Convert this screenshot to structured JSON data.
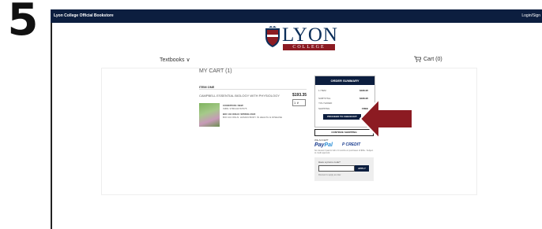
{
  "step_number": "5",
  "topbar": {
    "store_name": "Lyon College Official Bookstore",
    "login": "Login/Sign"
  },
  "logo": {
    "name": "LYON",
    "sub": "COLLEGE"
  },
  "nav": {
    "textbooks": "Textbooks ∨",
    "cart": "Cart (0)"
  },
  "cart": {
    "heading": "MY CART (1)",
    "section": "ITEM ONE",
    "item": {
      "title": "CAMPBELL ESSENTIAL BIOLOGY WITH PHYSIOLOGY",
      "price": "$193.35",
      "qty": "1 ∨",
      "condition": "CONDITION: NEW",
      "isbn": "ISBN: 9780134767575",
      "course1": "BIO 104 ONLN: SPRING 2022",
      "course2": "BIO 104 ONLN: HUMAN BODY IN HEALTH & DISEASE"
    }
  },
  "summary": {
    "header": "ORDER SUMMARY",
    "rows": [
      {
        "label": "1 ITEM",
        "value": "$189.95"
      },
      {
        "label": "SUBTOTAL",
        "value": "$189.95"
      },
      {
        "label": "YOU SAVED",
        "value": ""
      },
      {
        "label": "SHIPPING",
        "value": "FREE"
      }
    ],
    "checkout": "PROCEED TO CHECKOUT",
    "continue": "CONTINUE SHOPPING"
  },
  "payment": {
    "we_accept": "WE ACCEPT",
    "paypal_a": "Pay",
    "paypal_b": "Pal",
    "paypal_credit": "P CREDIT",
    "note": "No interest if paid in full in 6 months on purchases of $99+. Subject to credit approval."
  },
  "promo": {
    "label": "Have a promo code?",
    "apply": "APPLY",
    "note": "Discount to apply at order"
  },
  "colors": {
    "navy": "#0c1e3f",
    "arrow_red": "#8c1b22"
  }
}
